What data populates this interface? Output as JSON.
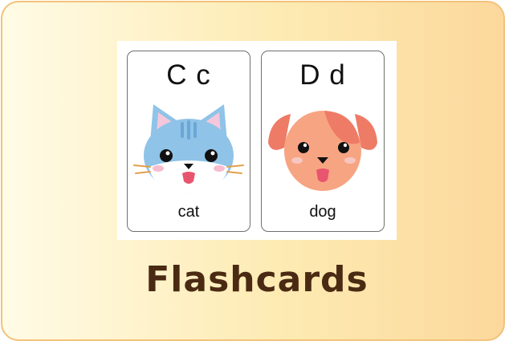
{
  "cards": [
    {
      "letters": "C c",
      "word": "cat",
      "icon": "cat-face-icon"
    },
    {
      "letters": "D d",
      "word": "dog",
      "icon": "dog-face-icon"
    }
  ],
  "title": "Flashcards",
  "colors": {
    "border": "#f2c27a",
    "title": "#4a2a12",
    "cat": "#8fc3e8",
    "dog": "#f7a482"
  }
}
